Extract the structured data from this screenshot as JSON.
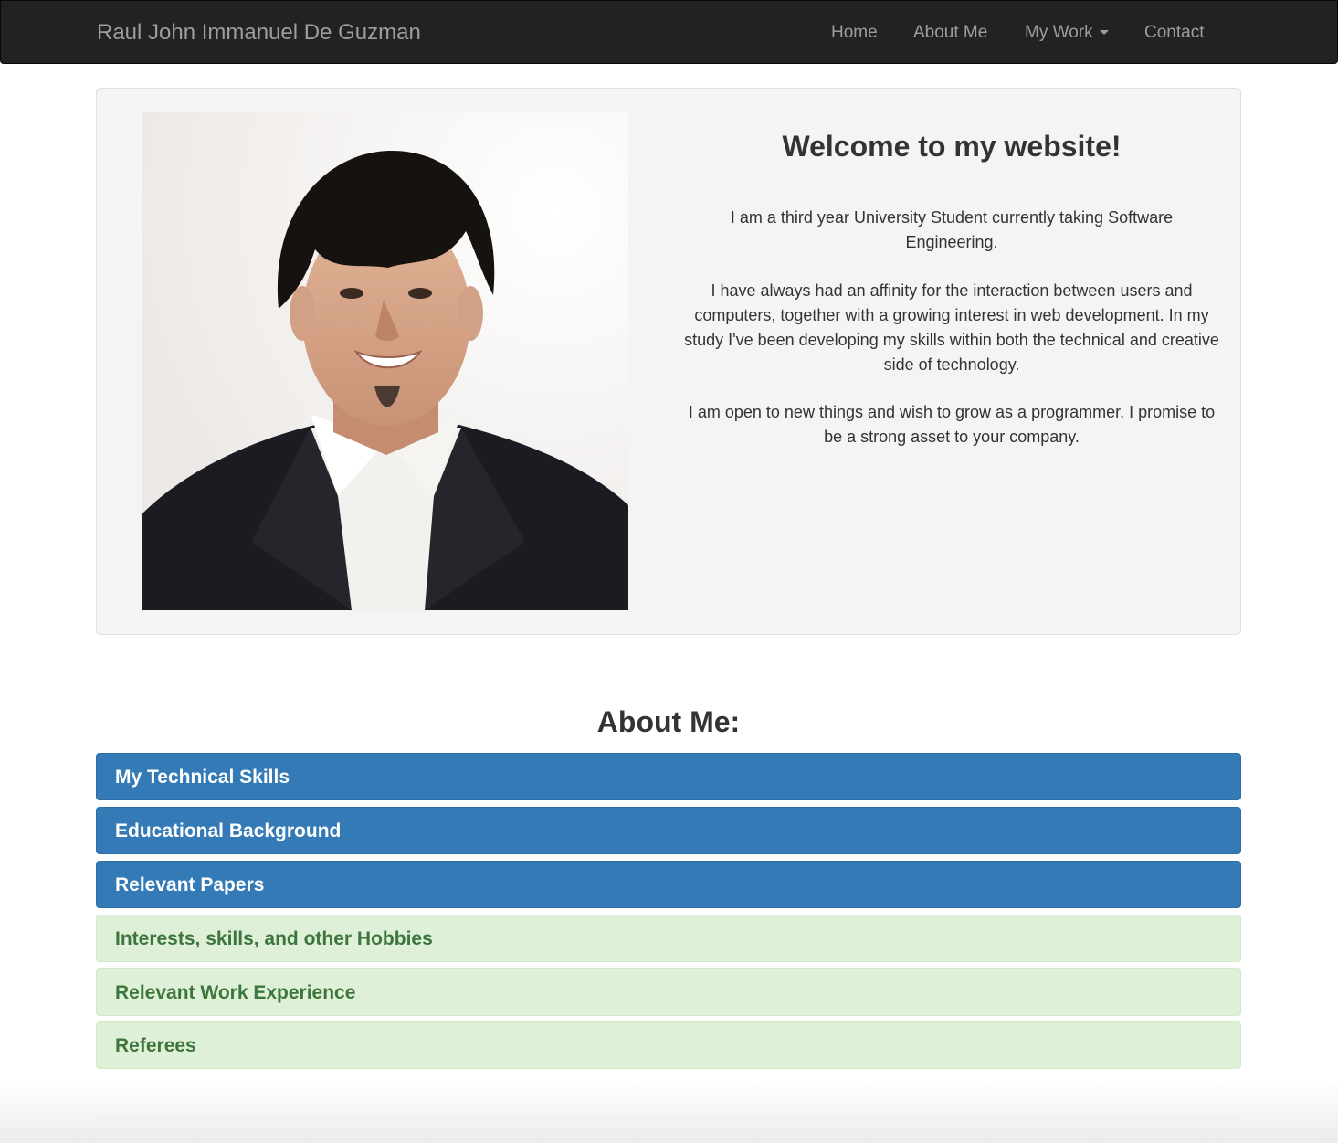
{
  "navbar": {
    "brand": "Raul John Immanuel De Guzman",
    "links": {
      "home": "Home",
      "about": "About Me",
      "work": "My Work",
      "contact": "Contact"
    }
  },
  "hero": {
    "title": "Welcome to my website!",
    "paragraphs": [
      "I am a third year University Student currently taking Software Engineering.",
      "I have always had an affinity for the interaction between users and computers, together with a growing interest in web development. In my study I've been developing my skills within both the technical and creative side of technology.",
      "I am open to new things and wish to grow as a programmer. I promise to be a strong asset to your company."
    ]
  },
  "about": {
    "title": "About Me:",
    "panels": [
      {
        "label": "My Technical Skills",
        "style": "primary"
      },
      {
        "label": "Educational Background",
        "style": "primary"
      },
      {
        "label": "Relevant Papers",
        "style": "primary"
      },
      {
        "label": "Interests, skills, and other Hobbies",
        "style": "success"
      },
      {
        "label": "Relevant Work Experience",
        "style": "success"
      },
      {
        "label": "Referees",
        "style": "success"
      }
    ]
  },
  "colors": {
    "navbar": "#222222",
    "nav_text": "#9d9d9d",
    "primary": "#337ab7",
    "success_bg": "#dff0d8",
    "success_text": "#3c763d",
    "jumbotron": "#f4f4f4"
  }
}
